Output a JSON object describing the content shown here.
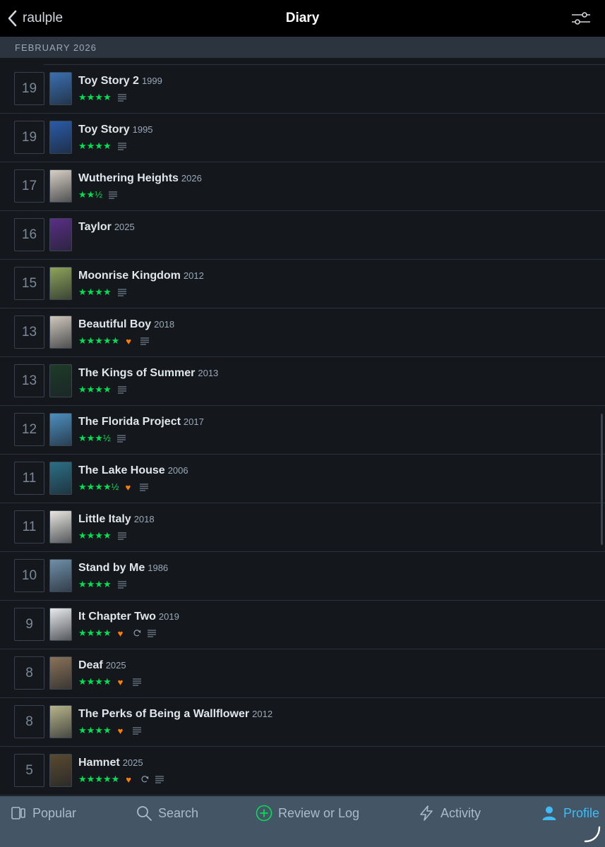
{
  "header": {
    "back_label": "raulple",
    "title": "Diary"
  },
  "section": {
    "month": "FEBRUARY 2026"
  },
  "entries": [
    {
      "day": "19",
      "title": "Toy Story 2",
      "year": "1999",
      "stars": "★★★★",
      "liked": false,
      "rewatch": false,
      "review": true,
      "poster_color": "#3a6fb0"
    },
    {
      "day": "19",
      "title": "Toy Story",
      "year": "1995",
      "stars": "★★★★",
      "liked": false,
      "rewatch": false,
      "review": true,
      "poster_color": "#2a5ba8"
    },
    {
      "day": "17",
      "title": "Wuthering Heights",
      "year": "2026",
      "stars": "★★½",
      "liked": false,
      "rewatch": false,
      "review": true,
      "poster_color": "#d8d0c4"
    },
    {
      "day": "16",
      "title": "Taylor",
      "year": "2025",
      "stars": "",
      "liked": false,
      "rewatch": false,
      "review": false,
      "poster_color": "#5a2f86"
    },
    {
      "day": "15",
      "title": "Moonrise Kingdom",
      "year": "2012",
      "stars": "★★★★",
      "liked": false,
      "rewatch": false,
      "review": true,
      "poster_color": "#8fa35a"
    },
    {
      "day": "13",
      "title": "Beautiful Boy",
      "year": "2018",
      "stars": "★★★★★",
      "liked": true,
      "rewatch": false,
      "review": true,
      "poster_color": "#cfc8bc"
    },
    {
      "day": "13",
      "title": "The Kings of Summer",
      "year": "2013",
      "stars": "★★★★",
      "liked": false,
      "rewatch": false,
      "review": true,
      "poster_color": "#1e3b28"
    },
    {
      "day": "12",
      "title": "The Florida Project",
      "year": "2017",
      "stars": "★★★½",
      "liked": false,
      "rewatch": false,
      "review": true,
      "poster_color": "#4d8fc0"
    },
    {
      "day": "11",
      "title": "The Lake House",
      "year": "2006",
      "stars": "★★★★½",
      "liked": true,
      "rewatch": false,
      "review": true,
      "poster_color": "#2b6f86"
    },
    {
      "day": "11",
      "title": "Little Italy",
      "year": "2018",
      "stars": "★★★★",
      "liked": false,
      "rewatch": false,
      "review": true,
      "poster_color": "#e8e6e0"
    },
    {
      "day": "10",
      "title": "Stand by Me",
      "year": "1986",
      "stars": "★★★★",
      "liked": false,
      "rewatch": false,
      "review": true,
      "poster_color": "#6f8fa8"
    },
    {
      "day": "9",
      "title": "It Chapter Two",
      "year": "2019",
      "stars": "★★★★",
      "liked": true,
      "rewatch": true,
      "review": true,
      "poster_color": "#e9eaec"
    },
    {
      "day": "8",
      "title": "Deaf",
      "year": "2025",
      "stars": "★★★★",
      "liked": true,
      "rewatch": false,
      "review": true,
      "poster_color": "#8a7258"
    },
    {
      "day": "8",
      "title": "The Perks of Being a Wallflower",
      "year": "2012",
      "stars": "★★★★",
      "liked": true,
      "rewatch": false,
      "review": true,
      "poster_color": "#b7b48a"
    },
    {
      "day": "5",
      "title": "Hamnet",
      "year": "2025",
      "stars": "★★★★★",
      "liked": true,
      "rewatch": true,
      "review": true,
      "poster_color": "#5a4a30"
    }
  ],
  "tabs": [
    {
      "label": "Popular",
      "icon": "popular-icon",
      "active": false
    },
    {
      "label": "Search",
      "icon": "search-icon",
      "active": false
    },
    {
      "label": "Review or Log",
      "icon": "plus-circle-icon",
      "active": false
    },
    {
      "label": "Activity",
      "icon": "lightning-icon",
      "active": false
    },
    {
      "label": "Profile",
      "icon": "person-icon",
      "active": true
    }
  ],
  "colors": {
    "star": "#00e054",
    "heart": "#ff8000",
    "active_tab": "#40bcf4",
    "add": "#00e054"
  }
}
